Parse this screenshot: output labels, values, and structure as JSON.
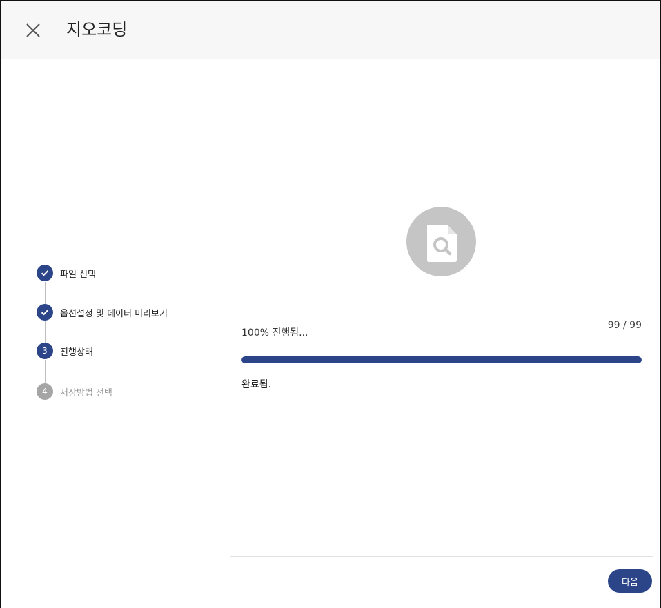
{
  "header": {
    "title": "지오코딩",
    "close_icon": "close-icon"
  },
  "stepper": {
    "steps": [
      {
        "number": "1",
        "label": "파일 선택",
        "state": "done"
      },
      {
        "number": "2",
        "label": "옵션설정 및 데이터 미리보기",
        "state": "done"
      },
      {
        "number": "3",
        "label": "진행상태",
        "state": "active"
      },
      {
        "number": "4",
        "label": "저장방법 선택",
        "state": "pending"
      }
    ]
  },
  "main": {
    "icon": "file-search-icon",
    "progress_label": "100% 진행됨...",
    "progress_count": "99 / 99",
    "progress_percent": 100,
    "status": "완료됨."
  },
  "footer": {
    "next_label": "다음"
  },
  "colors": {
    "accent": "#2b4588",
    "pending": "#a5a5a5",
    "icon_bg": "#c5c5c5"
  }
}
